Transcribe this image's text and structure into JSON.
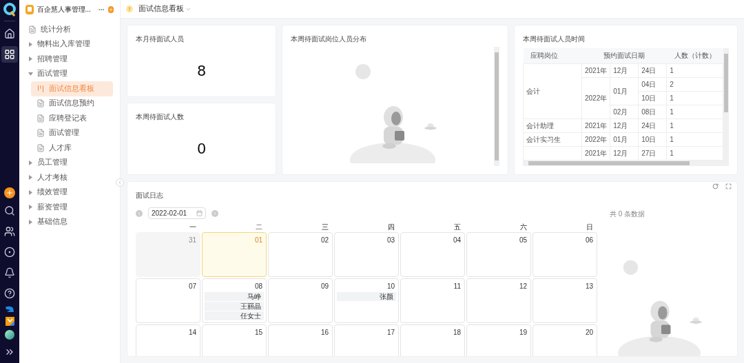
{
  "app": {
    "name": "百企慧人事管理..."
  },
  "rail": {
    "items": [
      {
        "selected": false
      },
      {
        "selected": true
      }
    ]
  },
  "sidebar": {
    "items": [
      {
        "label": "统计分析",
        "kind": "page",
        "selected": false
      },
      {
        "label": "物料出入库管理",
        "kind": "folder",
        "expanded": false
      },
      {
        "label": "招聘管理",
        "kind": "folder",
        "expanded": false
      },
      {
        "label": "面试管理",
        "kind": "folder",
        "expanded": true,
        "children": [
          {
            "label": "面试信息看板",
            "kind": "board",
            "selected": true
          },
          {
            "label": "面试信息预约",
            "kind": "page",
            "selected": false
          },
          {
            "label": "应聘登记表",
            "kind": "page",
            "selected": false
          },
          {
            "label": "面试管理",
            "kind": "page",
            "selected": false
          },
          {
            "label": "人才库",
            "kind": "page",
            "selected": false
          }
        ]
      },
      {
        "label": "员工管理",
        "kind": "folder",
        "expanded": false
      },
      {
        "label": "人才考核",
        "kind": "folder",
        "expanded": false
      },
      {
        "label": "绩效管理",
        "kind": "folder",
        "expanded": false
      },
      {
        "label": "薪资管理",
        "kind": "folder",
        "expanded": false
      },
      {
        "label": "基础信息",
        "kind": "folder",
        "expanded": false
      }
    ]
  },
  "header": {
    "title": "面试信息看板"
  },
  "stats": [
    {
      "title": "本月待面试人员",
      "value": "8"
    },
    {
      "title": "本周待面试人数",
      "value": "0"
    }
  ],
  "distribution": {
    "title": "本周待面试岗位人员分布"
  },
  "schedule": {
    "title": "本周待面试人员时间",
    "columns": [
      "应聘岗位",
      "预约面试日期",
      "人数（计数）"
    ],
    "groups": [
      {
        "position": "会计",
        "years": [
          {
            "year": "2021年",
            "months": [
              {
                "month": "12月",
                "days": [
                  {
                    "day": "24日",
                    "count": "1"
                  }
                ]
              }
            ]
          },
          {
            "year": "2022年",
            "months": [
              {
                "month": "01月",
                "days": [
                  {
                    "day": "04日",
                    "count": "2"
                  },
                  {
                    "day": "10日",
                    "count": "1"
                  }
                ]
              },
              {
                "month": "02月",
                "days": [
                  {
                    "day": "08日",
                    "count": "1"
                  }
                ]
              }
            ]
          }
        ]
      },
      {
        "position": "会计助理",
        "years": [
          {
            "year": "2021年",
            "months": [
              {
                "month": "12月",
                "days": [
                  {
                    "day": "24日",
                    "count": "1"
                  }
                ]
              }
            ]
          }
        ]
      },
      {
        "position": "会计实习生",
        "years": [
          {
            "year": "2022年",
            "months": [
              {
                "month": "01月",
                "days": [
                  {
                    "day": "10日",
                    "count": "1"
                  }
                ]
              }
            ]
          }
        ]
      },
      {
        "years": [
          {
            "year": "2021年",
            "months": [
              {
                "month": "12月",
                "days": [
                  {
                    "day": "27日",
                    "count": "1"
                  }
                ]
              }
            ]
          }
        ]
      }
    ]
  },
  "calendar": {
    "title": "面试日志",
    "date": "2022-02-01",
    "total": "共 0 条数据",
    "weekdays": [
      "一",
      "二",
      "三",
      "四",
      "五",
      "六",
      "日"
    ],
    "weeks": [
      {
        "days": [
          {
            "day": "31",
            "in_month": false,
            "selected": false
          },
          {
            "day": "01",
            "in_month": true,
            "selected": true
          },
          {
            "day": "02",
            "in_month": true,
            "selected": false
          },
          {
            "day": "03",
            "in_month": true,
            "selected": false
          },
          {
            "day": "04",
            "in_month": true,
            "selected": false
          },
          {
            "day": "05",
            "in_month": true,
            "selected": false
          },
          {
            "day": "06",
            "in_month": true,
            "selected": false
          }
        ]
      },
      {
        "days": [
          {
            "day": "07",
            "in_month": true,
            "selected": false
          },
          {
            "day": "08",
            "in_month": true,
            "selected": false,
            "events": [
              "马峥",
              "王丽晶",
              "任女士"
            ]
          },
          {
            "day": "09",
            "in_month": true,
            "selected": false
          },
          {
            "day": "10",
            "in_month": true,
            "selected": false,
            "events": [
              "张颜"
            ]
          },
          {
            "day": "11",
            "in_month": true,
            "selected": false
          },
          {
            "day": "12",
            "in_month": true,
            "selected": false
          },
          {
            "day": "13",
            "in_month": true,
            "selected": false
          }
        ]
      },
      {
        "days": [
          {
            "day": "14",
            "in_month": true,
            "selected": false
          },
          {
            "day": "15",
            "in_month": true,
            "selected": false
          },
          {
            "day": "16",
            "in_month": true,
            "selected": false
          },
          {
            "day": "17",
            "in_month": true,
            "selected": false
          },
          {
            "day": "18",
            "in_month": true,
            "selected": false
          },
          {
            "day": "19",
            "in_month": true,
            "selected": false
          },
          {
            "day": "20",
            "in_month": true,
            "selected": false
          }
        ]
      }
    ]
  }
}
